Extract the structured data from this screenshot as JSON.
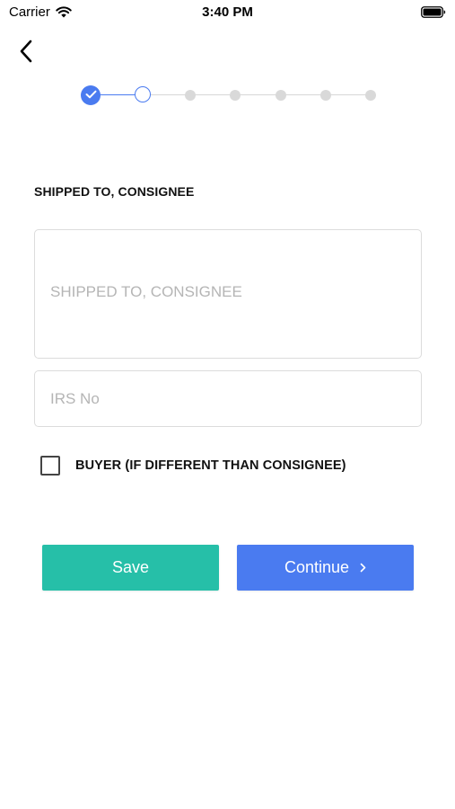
{
  "status_bar": {
    "carrier": "Carrier",
    "time": "3:40 PM"
  },
  "icons": {
    "back": "chevron-left-icon",
    "wifi": "wifi-icon",
    "battery": "battery-icon",
    "check": "check-icon",
    "continue": "chevron-right-icon"
  },
  "stepper": {
    "total_steps": 7,
    "completed_steps": 1,
    "current_step": 2
  },
  "form": {
    "section_title": "SHIPPED TO, CONSIGNEE",
    "consignee_placeholder": "SHIPPED TO, CONSIGNEE",
    "consignee_value": "",
    "irs_placeholder": "IRS No",
    "irs_value": "",
    "buyer_checkbox_label": "BUYER (IF DIFFERENT THAN CONSIGNEE)",
    "buyer_checked": false
  },
  "actions": {
    "save_label": "Save",
    "continue_label": "Continue"
  },
  "colors": {
    "accent_blue": "#4a7bf0",
    "save_green": "#26bfa8",
    "continue_blue": "#4a7bf0",
    "field_border": "#dcdcdc",
    "placeholder": "#b5b5b5"
  }
}
